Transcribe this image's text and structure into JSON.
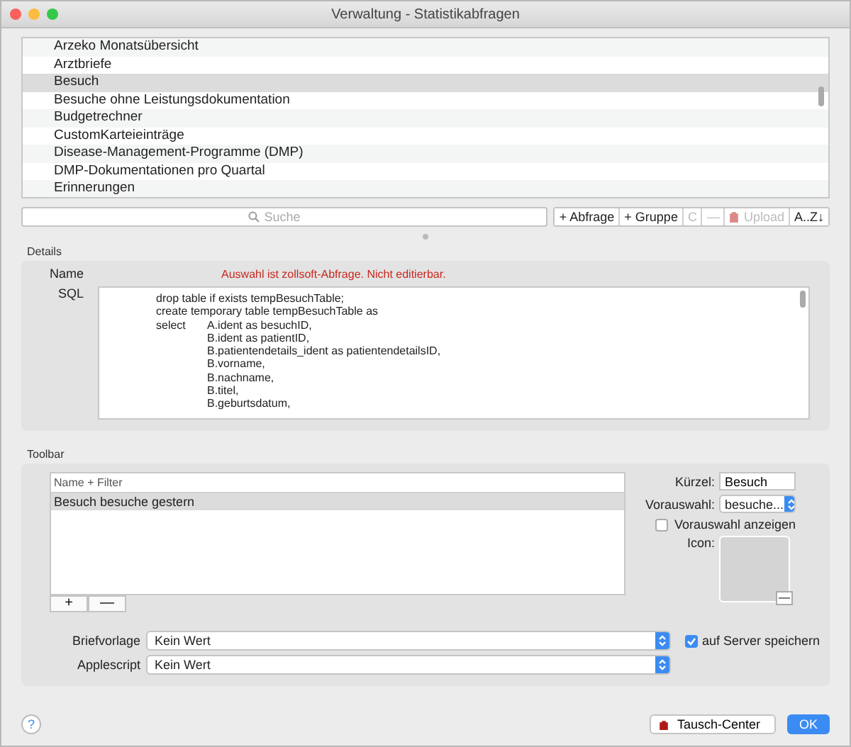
{
  "window": {
    "title": "Verwaltung - Statistikabfragen"
  },
  "queries": [
    {
      "label": "Arzeko Monatsübersicht",
      "selected": false
    },
    {
      "label": "Arztbriefe",
      "selected": false
    },
    {
      "label": "Besuch",
      "selected": true
    },
    {
      "label": "Besuche ohne Leistungsdokumentation",
      "selected": false
    },
    {
      "label": "Budgetrechner",
      "selected": false
    },
    {
      "label": "CustomKarteieinträge",
      "selected": false
    },
    {
      "label": "Disease-Management-Programme (DMP)",
      "selected": false
    },
    {
      "label": "DMP-Dokumentationen pro Quartal",
      "selected": false
    },
    {
      "label": "Erinnerungen",
      "selected": false
    }
  ],
  "search": {
    "placeholder": "Suche"
  },
  "toolbar_buttons": [
    {
      "label": "+ Abfrage",
      "kind": "text",
      "disabled": false
    },
    {
      "label": "+ Gruppe",
      "kind": "text",
      "disabled": false
    },
    {
      "label": "C",
      "kind": "text",
      "disabled": true
    },
    {
      "label": "—",
      "kind": "text",
      "disabled": true
    },
    {
      "label": "Upload",
      "kind": "upload",
      "disabled": true
    },
    {
      "label": "A..Z↓",
      "kind": "text",
      "disabled": false
    }
  ],
  "details": {
    "title": "Details",
    "name_label": "Name",
    "name_warning": "Auswahl ist zollsoft-Abfrage. Nicht editierbar.",
    "sql_label": "SQL",
    "sql": "\tdrop table if exists tempBesuchTable;\n\tcreate temporary table tempBesuchTable as\n\tselect\tA.ident as besuchID,\n\t\tB.ident as patientID,\n\t\tB.patientendetails_ident as patientendetailsID,\n\t\tB.vorname,\n\t\tB.nachname,\n\t\tB.titel,\n\t\tB.geburtsdatum,"
  },
  "toolbar": {
    "title": "Toolbar",
    "filter_placeholder": "Name + Filter",
    "items": [
      {
        "label": "Besuch besuche gestern",
        "selected": true
      }
    ],
    "add": "+",
    "remove": "—",
    "kuerzel_label": "Kürzel:",
    "kuerzel": "Besuch",
    "vorauswahl_label": "Vorauswahl:",
    "vorauswahl": "besuche...",
    "show_preselection": {
      "label": "Vorauswahl anzeigen",
      "checked": false
    },
    "icon_label": "Icon:",
    "icon_remove": "—"
  },
  "briefvorlage": {
    "label": "Briefvorlage",
    "value": "Kein Wert"
  },
  "applescript": {
    "label": "Applescript",
    "value": "Kein Wert"
  },
  "save_on_server": {
    "label": "auf Server speichern",
    "checked": true
  },
  "footer": {
    "help": "?",
    "exchange": "Tausch-Center",
    "ok": "OK"
  }
}
